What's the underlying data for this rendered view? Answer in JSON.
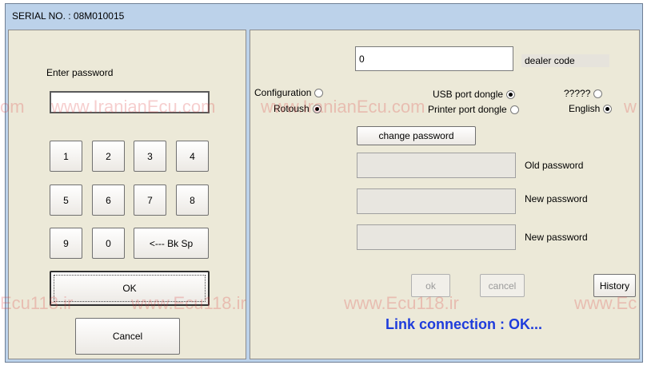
{
  "window": {
    "title_prefix": "SERIAL NO. :",
    "serial": "08M010015"
  },
  "left": {
    "enter_password_label": "Enter password",
    "password_value": "",
    "keys": [
      "1",
      "2",
      "3",
      "4",
      "5",
      "6",
      "7",
      "8",
      "9",
      "0",
      "<--- Bk Sp"
    ],
    "ok_label": "OK",
    "cancel_label": "Cancel"
  },
  "right": {
    "dealer_code_value": "0",
    "dealer_code_label": "dealer code",
    "options": [
      {
        "label": "Configuration",
        "selected": false
      },
      {
        "label": "Rotoush",
        "selected": true
      },
      {
        "label": "USB port dongle",
        "selected": true
      },
      {
        "label": "Printer port dongle",
        "selected": false
      },
      {
        "label": "?????",
        "selected": false
      },
      {
        "label": "English",
        "selected": true
      }
    ],
    "change_password_label": "change password",
    "old_password_label": "Old password",
    "new_password_label": "New password",
    "new_password_label_2": "New password",
    "ok_label": "ok",
    "cancel_label": "cancel",
    "history_label": "History",
    "status_text": "Link connection : OK..."
  },
  "watermarks": {
    "top_row": [
      "om",
      "www.IranianEcu.com",
      "www.IranianEcu.com",
      "w"
    ],
    "bottom_row": [
      "Ecu118.ir",
      "www.Ecu118.ir",
      "www.Ecu118.ir",
      "www.Ec"
    ]
  }
}
